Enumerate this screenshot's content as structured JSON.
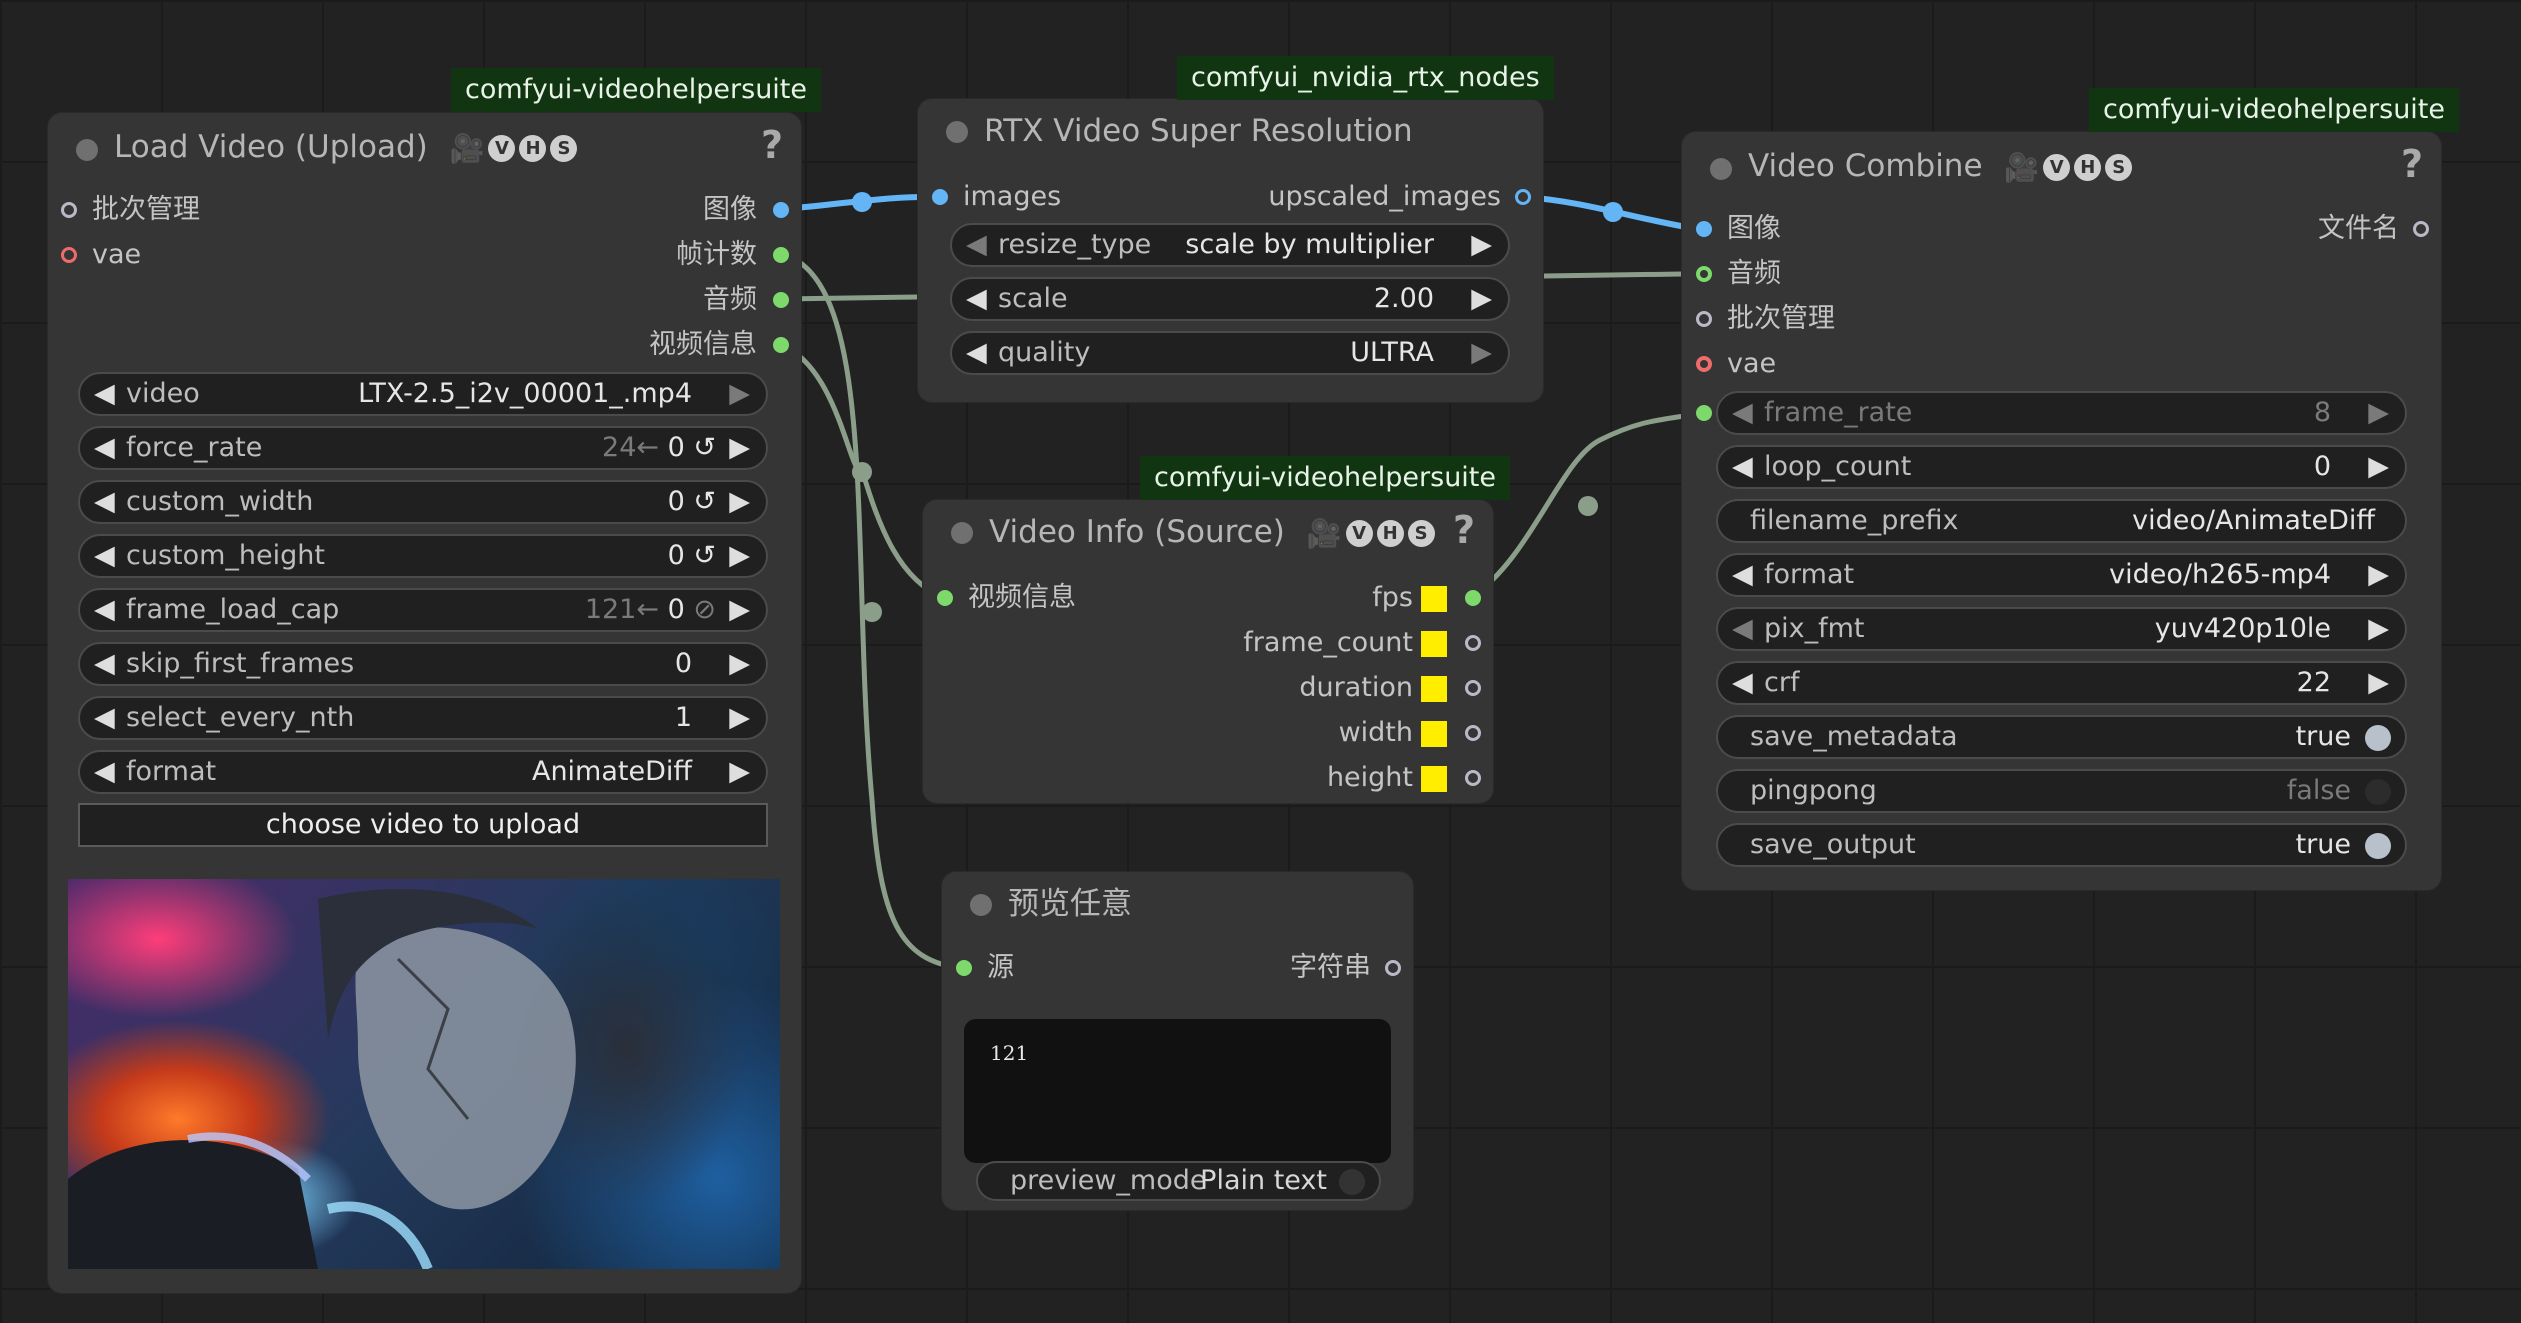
{
  "packs": {
    "load_video": "comfyui-videohelpersuite",
    "rtx": "comfyui_nvidia_rtx_nodes",
    "video_combine": "comfyui-videohelpersuite",
    "video_info": "comfyui-videohelpersuite"
  },
  "load_video": {
    "title": "Load Video (Upload)",
    "badges": [
      "V",
      "H",
      "S"
    ],
    "help": "?",
    "inputs": [
      "批次管理",
      "vae"
    ],
    "outputs": [
      "图像",
      "帧计数",
      "音频",
      "视频信息"
    ],
    "widgets": [
      {
        "name": "video",
        "value": "LTX-2.5_i2v_00001_.mp4"
      },
      {
        "name": "force_rate",
        "hint": "24←",
        "value": "0",
        "suffix": "↺"
      },
      {
        "name": "custom_width",
        "value": "0",
        "suffix": "↺"
      },
      {
        "name": "custom_height",
        "value": "0",
        "suffix": "↺"
      },
      {
        "name": "frame_load_cap",
        "hint": "121←",
        "value": "0",
        "suffix": "⊘"
      },
      {
        "name": "skip_first_frames",
        "value": "0"
      },
      {
        "name": "select_every_nth",
        "value": "1"
      },
      {
        "name": "format",
        "value": "AnimateDiff"
      }
    ],
    "upload_button": "choose video to upload"
  },
  "rtx": {
    "title": "RTX Video Super Resolution",
    "input": "images",
    "output": "upscaled_images",
    "widgets": [
      {
        "name": "resize_type",
        "value": "scale by multiplier"
      },
      {
        "name": "scale",
        "value": "2.00"
      },
      {
        "name": "quality",
        "value": "ULTRA"
      }
    ]
  },
  "video_info": {
    "title": "Video Info (Source)",
    "badges": [
      "V",
      "H",
      "S"
    ],
    "help": "?",
    "input": "视频信息",
    "outputs": [
      "fps",
      "frame_count",
      "duration",
      "width",
      "height"
    ]
  },
  "preview": {
    "title": "预览任意",
    "input": "源",
    "output": "字符串",
    "text": "121",
    "mode_label": "preview_mode",
    "mode_value": "Plain text"
  },
  "video_combine": {
    "title": "Video Combine",
    "badges": [
      "V",
      "H",
      "S"
    ],
    "help": "?",
    "inputs": [
      "图像",
      "音频",
      "批次管理",
      "vae"
    ],
    "output": "文件名",
    "widgets": [
      {
        "name": "frame_rate",
        "value": "8"
      },
      {
        "name": "loop_count",
        "value": "0"
      },
      {
        "name": "filename_prefix",
        "value": "video/AnimateDiff"
      },
      {
        "name": "format",
        "value": "video/h265-mp4"
      },
      {
        "name": "pix_fmt",
        "value": "yuv420p10le"
      },
      {
        "name": "crf",
        "value": "22"
      }
    ],
    "toggles": [
      {
        "name": "save_metadata",
        "value": "true"
      },
      {
        "name": "pingpong",
        "value": "false"
      },
      {
        "name": "save_output",
        "value": "true"
      }
    ]
  },
  "colors": {
    "background": "#222222",
    "node": "#353535",
    "image_link": "#64b5f6",
    "int_link": "#8a9e8a",
    "slot_green": "#7dd96b",
    "slot_red": "#f06b6b",
    "slot_blue": "#64b5f6",
    "slot_gray": "#8f8fa8",
    "pack_bg": "#103510"
  }
}
